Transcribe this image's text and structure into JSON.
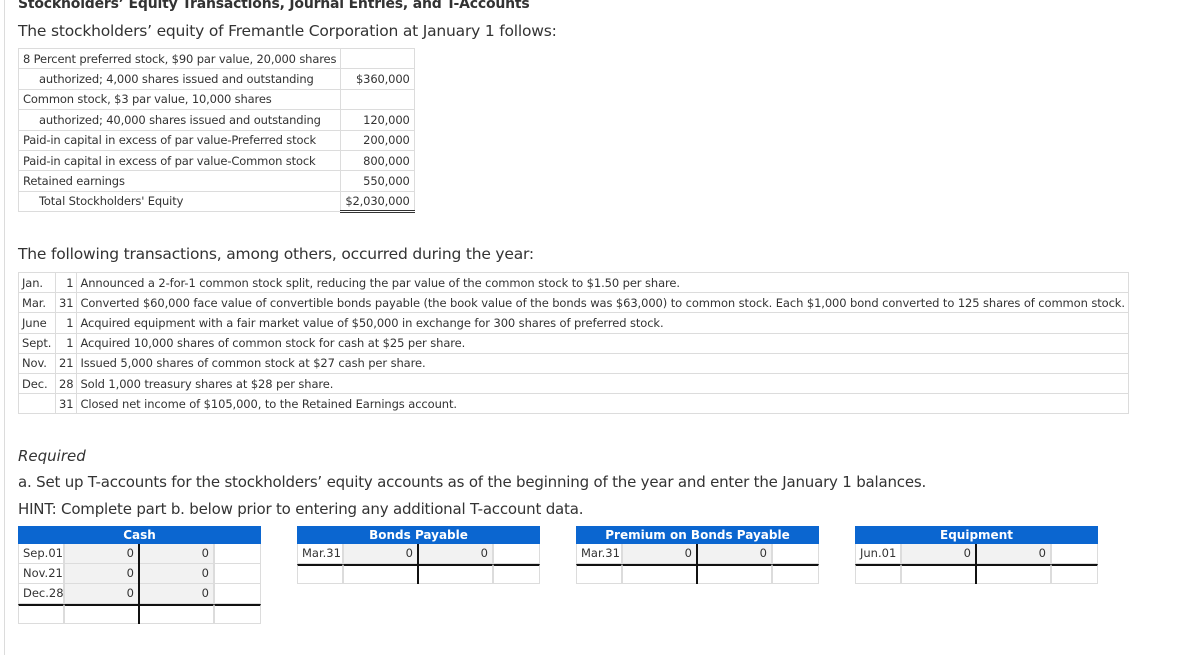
{
  "page_title": "Stockholders’ Equity Transactions, Journal Entries, and T-Accounts",
  "intro": "The stockholders’ equity of Fremantle Corporation at January 1 follows:",
  "equity_table": {
    "rows": [
      {
        "label": "8 Percent preferred stock, $90 par value, 20,000 shares",
        "amount": ""
      },
      {
        "label": "authorized; 4,000 shares issued and outstanding",
        "amount": "$360,000"
      },
      {
        "label": "Common stock, $3 par value, 10,000 shares",
        "amount": ""
      },
      {
        "label": "authorized; 40,000 shares issued and outstanding",
        "amount": "120,000"
      },
      {
        "label": "Paid-in capital in excess of par value-Preferred stock",
        "amount": "200,000"
      },
      {
        "label": "Paid-in capital in excess of par value-Common stock",
        "amount": "800,000"
      },
      {
        "label": "Retained earnings",
        "amount": "550,000"
      },
      {
        "label": "Total Stockholders' Equity",
        "amount": "$2,030,000"
      }
    ]
  },
  "transactions_intro": "The following transactions, among others, occurred during the year:",
  "transactions": [
    {
      "month": "Jan.",
      "day": "1",
      "description": "Announced a 2-for-1 common stock split, reducing the par value of the common stock to $1.50 per share."
    },
    {
      "month": "Mar.",
      "day": "31",
      "description": "Converted $60,000 face value of convertible bonds payable (the book value of the bonds was $63,000) to common stock. Each $1,000 bond converted to 125 shares of common stock."
    },
    {
      "month": "June",
      "day": "1",
      "description": "Acquired equipment with a fair market value of $50,000 in exchange for 300 shares of preferred stock."
    },
    {
      "month": "Sept.",
      "day": "1",
      "description": "Acquired 10,000 shares of common stock for cash at $25 per share."
    },
    {
      "month": "Nov.",
      "day": "21",
      "description": "Issued 5,000 shares of common stock at $27 cash per share."
    },
    {
      "month": "Dec.",
      "day": "28",
      "description": "Sold 1,000 treasury shares at $28 per share."
    },
    {
      "month": "",
      "day": "31",
      "description": "Closed net income of $105,000, to the Retained Earnings account."
    }
  ],
  "required_label": "Required",
  "part_a": "a. Set up T-accounts for the stockholders’ equity accounts as of the beginning of the year and enter the January 1 balances.",
  "hint": "HINT: Complete part b. below prior to entering any additional T-account data.",
  "colors": {
    "t_account_header": "#0b66d0"
  },
  "t_accounts": [
    {
      "title": "Cash",
      "rows": [
        {
          "date": "Sep.01",
          "debit": "0",
          "credit": "0",
          "extra": ""
        },
        {
          "date": "Nov.21",
          "debit": "0",
          "credit": "0",
          "extra": ""
        },
        {
          "date": "Dec.28",
          "debit": "0",
          "credit": "0",
          "extra": ""
        }
      ],
      "total": {
        "date": "",
        "debit": "",
        "credit": "",
        "extra": ""
      }
    },
    {
      "title": "Bonds Payable",
      "rows": [
        {
          "date": "Mar.31",
          "debit": "0",
          "credit": "0",
          "extra": ""
        }
      ],
      "total": {
        "date": "",
        "debit": "",
        "credit": "",
        "extra": ""
      }
    },
    {
      "title": "Premium on Bonds Payable",
      "rows": [
        {
          "date": "Mar.31",
          "debit": "0",
          "credit": "0",
          "extra": ""
        }
      ],
      "total": {
        "date": "",
        "debit": "",
        "credit": "",
        "extra": ""
      }
    },
    {
      "title": "Equipment",
      "rows": [
        {
          "date": "Jun.01",
          "debit": "0",
          "credit": "0",
          "extra": ""
        }
      ],
      "total": {
        "date": "",
        "debit": "",
        "credit": "",
        "extra": ""
      }
    }
  ]
}
